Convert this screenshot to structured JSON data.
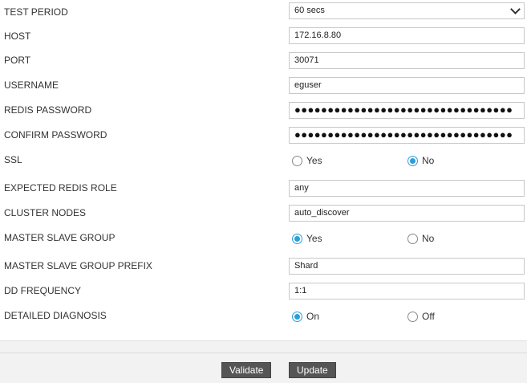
{
  "form": {
    "test_period": {
      "label": "TEST PERIOD",
      "value": "60 secs"
    },
    "host": {
      "label": "HOST",
      "value": "172.16.8.80"
    },
    "port": {
      "label": "PORT",
      "value": "30071"
    },
    "username": {
      "label": "USERNAME",
      "value": "eguser"
    },
    "redis_password": {
      "label": "REDIS PASSWORD",
      "value": "●●●●●●●●●●●●●●●●●●●●●●●●●●●●●●●●●"
    },
    "confirm_password": {
      "label": "CONFIRM PASSWORD",
      "value": "●●●●●●●●●●●●●●●●●●●●●●●●●●●●●●●●●"
    },
    "ssl": {
      "label": "SSL",
      "options": [
        "Yes",
        "No"
      ],
      "selected": "No"
    },
    "expected_redis_role": {
      "label": "EXPECTED REDIS ROLE",
      "value": "any"
    },
    "cluster_nodes": {
      "label": "CLUSTER NODES",
      "value": "auto_discover"
    },
    "master_slave_group": {
      "label": "MASTER SLAVE GROUP",
      "options": [
        "Yes",
        "No"
      ],
      "selected": "Yes"
    },
    "master_slave_group_prefix": {
      "label": "MASTER SLAVE GROUP PREFIX",
      "value": "Shard"
    },
    "dd_frequency": {
      "label": "DD FREQUENCY",
      "value": "1:1"
    },
    "detailed_diagnosis": {
      "label": "DETAILED DIAGNOSIS",
      "options": [
        "On",
        "Off"
      ],
      "selected": "On"
    }
  },
  "footer": {
    "validate_label": "Validate",
    "update_label": "Update"
  },
  "colors": {
    "accent": "#2a9fd8",
    "button_bg": "#555555",
    "footer_bg": "#f2f2f2"
  }
}
